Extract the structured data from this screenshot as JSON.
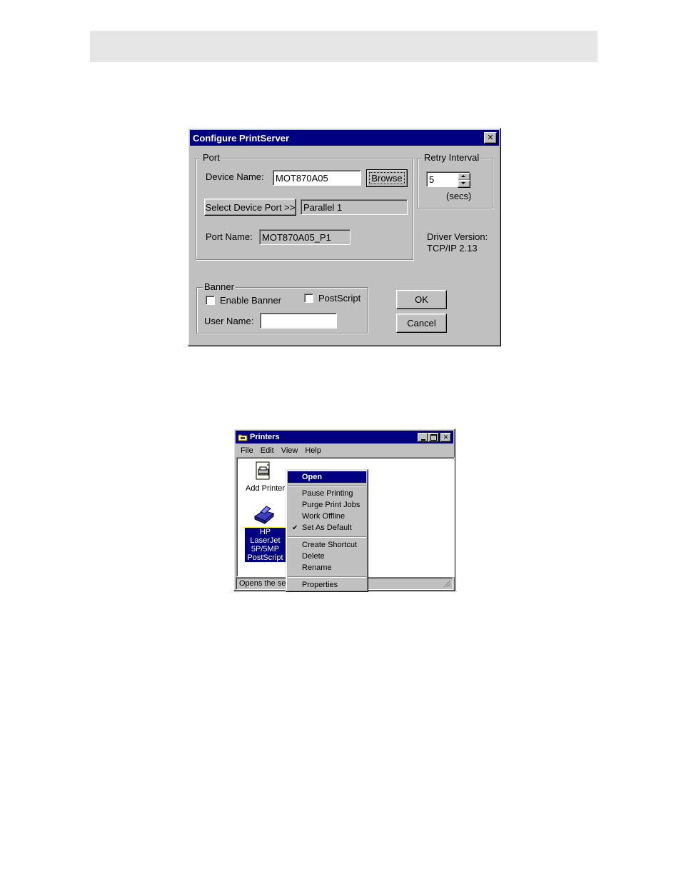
{
  "configure_dialog": {
    "title": "Configure PrintServer",
    "close_glyph": "✕",
    "port_group": {
      "label": "Port",
      "device_name_label": "Device Name:",
      "device_name_value": "MOT870A05",
      "browse_label": "Browse",
      "select_device_port_label": "Select Device Port >>",
      "device_port_value": "Parallel 1",
      "port_name_label": "Port Name:",
      "port_name_value": "MOT870A05_P1"
    },
    "retry_group": {
      "label": "Retry Interval",
      "value": "5",
      "units": "(secs)"
    },
    "driver_version_label": "Driver Version:",
    "driver_version_value": "TCP/IP  2.13",
    "banner_group": {
      "label": "Banner",
      "enable_banner_label": "Enable Banner",
      "enable_banner_checked": false,
      "postscript_label": "PostScript",
      "postscript_checked": false,
      "user_name_label": "User Name:",
      "user_name_value": ""
    },
    "ok_label": "OK",
    "cancel_label": "Cancel"
  },
  "printers_window": {
    "title": "Printers",
    "menu": [
      "File",
      "Edit",
      "View",
      "Help"
    ],
    "icons": {
      "add_printer_label": "Add Printer",
      "hp_printer_lines": [
        "HP LaserJet",
        "5P/5MP",
        "PostScript"
      ]
    },
    "status_text": "Opens the sele",
    "context_menu": {
      "open": "Open",
      "pause_printing": "Pause Printing",
      "purge_print_jobs": "Purge Print Jobs",
      "work_offline": "Work Offline",
      "set_as_default": "Set As Default",
      "create_shortcut": "Create Shortcut",
      "delete": "Delete",
      "rename": "Rename",
      "properties": "Properties"
    }
  },
  "colors": {
    "title_bar": "#000080",
    "face": "#c0c0c0",
    "header_bar": "#e6e6e6"
  }
}
